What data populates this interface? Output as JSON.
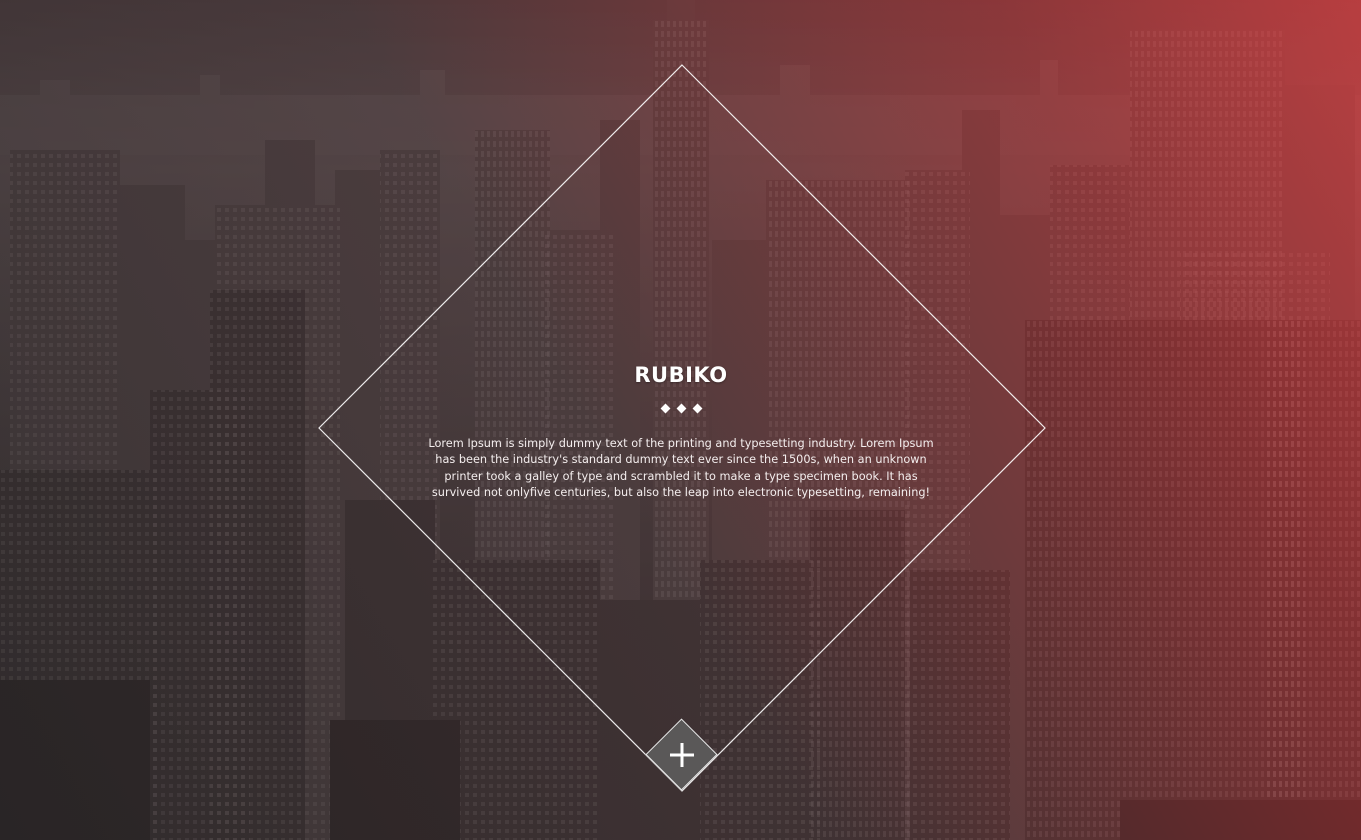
{
  "hero": {
    "brand": "RUBIKO",
    "description": "Lorem Ipsum is simply dummy text of the printing and typesetting industry. Lorem Ipsum has been the industry's standard dummy text ever since the 1500s, when an unknown printer took a galley of type and scrambled it to make a type specimen book. It has survived not onlyfive centuries, but also the leap into electronic typesetting, remaining!",
    "separator_icon": "three-diamond-separator-icon",
    "action_icon": "plus-icon"
  },
  "colors": {
    "accent_red": "#d94448",
    "frame_line": "#ffffff",
    "button_fill": "#5a5858"
  }
}
